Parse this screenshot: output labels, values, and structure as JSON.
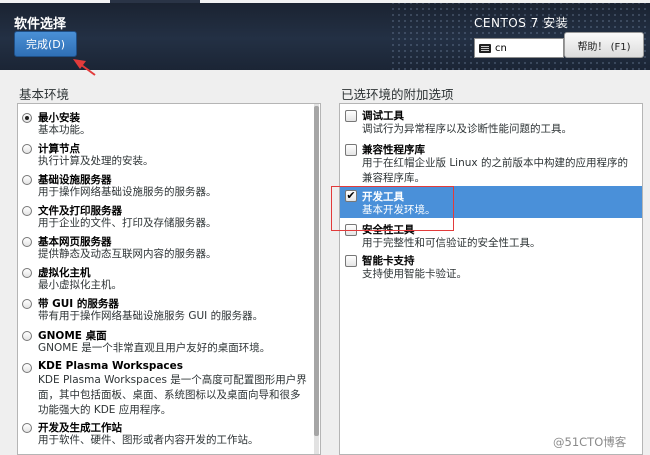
{
  "header": {
    "title": "软件选择",
    "done_button": "完成(D)",
    "os_title": "CENTOS 7 安装",
    "keyboard_value": "cn",
    "help_button": "帮助！ (F1)"
  },
  "base_env": {
    "label": "基本环境",
    "items": [
      {
        "name": "最小安装",
        "desc": "基本功能。",
        "selected": true
      },
      {
        "name": "计算节点",
        "desc": "执行计算及处理的安装。",
        "selected": false
      },
      {
        "name": "基础设施服务器",
        "desc": "用于操作网络基础设施服务的服务器。",
        "selected": false
      },
      {
        "name": "文件及打印服务器",
        "desc": "用于企业的文件、打印及存储服务器。",
        "selected": false
      },
      {
        "name": "基本网页服务器",
        "desc": "提供静态及动态互联网内容的服务器。",
        "selected": false
      },
      {
        "name": "虚拟化主机",
        "desc": "最小虚拟化主机。",
        "selected": false
      },
      {
        "name": "带 GUI 的服务器",
        "desc": "带有用于操作网络基础设施服务 GUI 的服务器。",
        "selected": false
      },
      {
        "name": "GNOME 桌面",
        "desc": "GNOME 是一个非常直观且用户友好的桌面环境。",
        "selected": false
      },
      {
        "name": "KDE Plasma Workspaces",
        "desc_lines": [
          "KDE Plasma Workspaces 是一个高度可配置图形用户界",
          "面，其中包括面板、桌面、系统图标以及桌面向导和很多",
          "功能强大的 KDE 应用程序。"
        ],
        "selected": false
      },
      {
        "name": "开发及生成工作站",
        "desc": "用于软件、硬件、图形或者内容开发的工作站。",
        "selected": false
      }
    ]
  },
  "addons": {
    "label": "已选环境的附加选项",
    "items": [
      {
        "name": "调试工具",
        "desc": "调试行为异常程序以及诊断性能问题的工具。",
        "checked": false
      },
      {
        "name": "兼容性程序库",
        "desc_lines": [
          "用于在红帽企业版 Linux 的之前版本中构建的应用程序的",
          "兼容程序库。"
        ],
        "checked": false
      },
      {
        "name": "开发工具",
        "desc": "基本开发环境。",
        "checked": true
      },
      {
        "name": "安全性工具",
        "desc": "用于完整性和可信验证的安全性工具。",
        "checked": false
      },
      {
        "name": "智能卡支持",
        "desc": "支持使用智能卡验证。",
        "checked": false
      }
    ]
  },
  "watermark": "@51CTO博客",
  "colors": {
    "header_bg": "#1b2535",
    "accent": "#4a90d9",
    "highlight_box": "#e23b3b",
    "arrow": "#e23b3b"
  }
}
